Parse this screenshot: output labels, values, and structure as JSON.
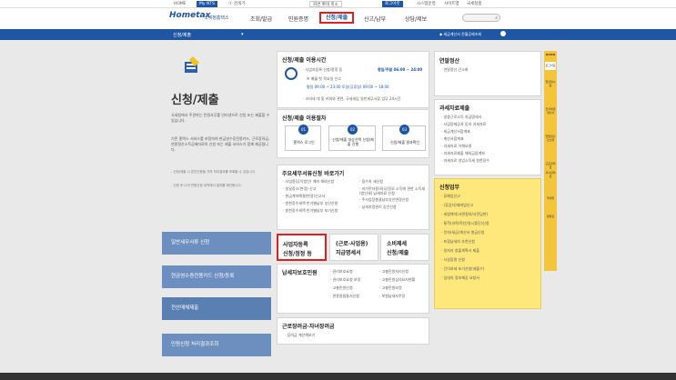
{
  "topbar": {
    "links": [
      "HOME",
      "My NTS",
      "ⓐ 검색기"
    ],
    "btn_a": "화면 확대 축소",
    "btn_b": "로그아웃",
    "right_links": [
      "시스템운영",
      "사이트맵",
      "국세청홈"
    ]
  },
  "header": {
    "logo": "Hometax",
    "logo_sub": "국세청홈택스",
    "nav": [
      "조회/발급",
      "민원증명",
      "신청/제출",
      "신고/납부",
      "상담/제보"
    ],
    "search_placeholder": ""
  },
  "navband": {
    "breadcrumb": "신청/제출",
    "notice": "◆ 세금계산서 전월공제조회",
    "right": ""
  },
  "hero": {
    "title": "신청/제출",
    "desc": "국세청에서 주관하는 민원사무를 인터넷으로 신청 또는 제출할 수 있습니다.",
    "desc2": "기존 홈택스 서비스를 포함하여 현금영수증전용카드, 근로장려금, 연말정산소득공제자료의 신청 또는 제출 서비스가 함께 제공됩니다.",
    "note1": "- 신청/제출 시 본인인증을 거쳐 처리결과를 조회할 수 있습니다.",
    "note2": "- 신청 후 나의 민원신청 내역에서 결과를 확인합니다."
  },
  "left_menu": [
    "일반세무서류 신청",
    "현금영수증전용카드 신청/등록",
    "전산매체제출",
    "민원신청 처리결과조회"
  ],
  "usage_time": {
    "title": "신청/제출 이용시간",
    "line1": "· 사업자등록 신청/정정 등",
    "line1b": "평일/주말 06:00 ~ 24:00",
    "line2": "※ 매월 첫 목요일 신고",
    "line3": "평일 09:00 ~ 23:00 토일(공휴일) 09:00 ~ 18:00",
    "line4": "· 소비세 대 및 커피와 관련, 국세세입 일반세무서류 업무 24시간"
  },
  "procedure": {
    "title": "신청/제출 이용절차",
    "steps": [
      {
        "num": "01",
        "label": "홈택스 로그인"
      },
      {
        "num": "02",
        "label": "신청/제출 대상선택 신청/제출 진행"
      },
      {
        "num": "03",
        "label": "신청/제출 결과확인"
      }
    ]
  },
  "quick": {
    "title": "주요세무서류신청 바로가기",
    "col1": [
      "· 사업용(공익법인) 계좌 해외신청",
      "· 송달장소(변경) 신고",
      "· 현금계약해결(변경)신고서",
      "· 원천징수세액 반기별납부 승인신청",
      "· 원천징수세액 반기별납부 포기신청"
    ],
    "col2": [
      "· 접수처 세신청",
      "· 비거주자용(외국)정부 소득에 관한 소득세(법인세) 납세자료 신청",
      "· 주사업장총괄납부승인변경신청",
      "· 납세지정관리 승인신청"
    ]
  },
  "tiles": [
    {
      "l1": "사업자등록",
      "l2": "신청/정정 등"
    },
    {
      "l1": "(근로·사업용)",
      "l2": "지급명세서"
    },
    {
      "l1": "소비제세",
      "l2": "신청/제출"
    }
  ],
  "relief": {
    "title": "납세자보호민원",
    "col1": [
      "· 권리보호요청",
      "· 권리보호요청 보정",
      "· 고충민원신청",
      "· 관용용법통지신청"
    ],
    "col2": [
      "· 고충민원처리신청",
      "· 고충민원심의요지현황",
      "· 고충민원보정",
      "· 보험납세자주장"
    ]
  },
  "incentive": {
    "title": "근로장려금·자녀장려금",
    "item": "· 장려금 계산해보기"
  },
  "year_end": {
    "title": "연말정산",
    "item": "· 연말정산 간소화"
  },
  "tax_data": {
    "title": "과세자료제출",
    "items": [
      "· 일용근로소득 지급명세서",
      "· 사업장제공자 등의 과세자료",
      "· 세금계산서합계표",
      "· 계산서합계표",
      "· 과세자료 이해요령",
      "· 과세자료제출 해외금융계좌",
      "· 과세자료 영업소득세 원천징수"
    ]
  },
  "legal": {
    "title": "신청업무",
    "items": [
      "· 휴폐업신고",
      "· (휴업자)재개업신고",
      "· 세법해석(서면질의/사전답변)",
      "· 통학(과목/학년/일시중단)신청",
      "· 전자(세금)계산서 발급신청",
      "· 포함납세자 추천신청",
      "· 일자리 창출계획서 제출",
      "· 사실증명 신청",
      "· 간이과세 포기신청(제출수)",
      "· 입대차 정보제공 요청서"
    ]
  },
  "rightbar": [
    "QUICK",
    "로그아웃",
    "현금영수증",
    "전자세금계산서",
    "연말정산간소화",
    "근로장려금",
    "자녀장려금",
    "국세청",
    "맨위로"
  ]
}
